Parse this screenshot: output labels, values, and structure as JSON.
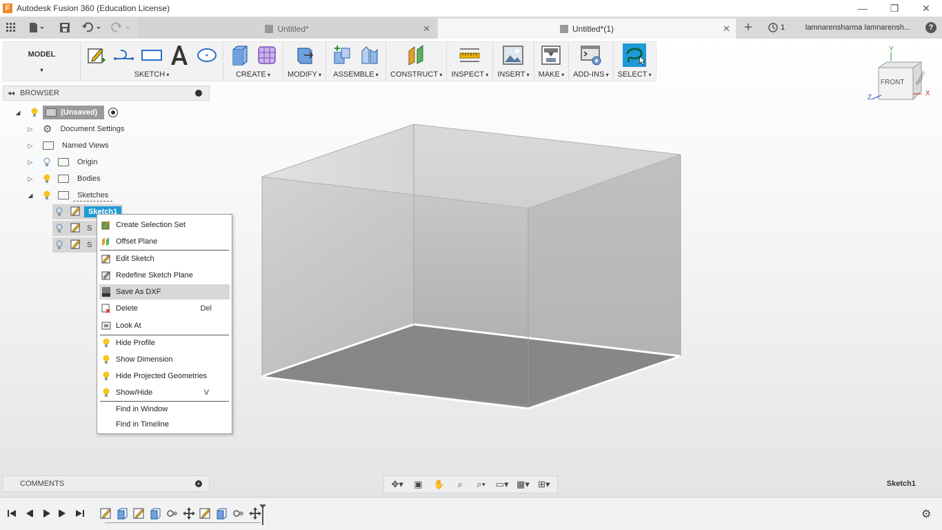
{
  "window": {
    "title": "Autodesk Fusion 360 (Education License)",
    "logo_letter": "F"
  },
  "tabs": [
    {
      "label": "Untitled*",
      "active": false
    },
    {
      "label": "Untitled*(1)",
      "active": true
    }
  ],
  "header": {
    "job_count": "1",
    "user": "lamnarensharma lamnarensh...",
    "help": "?"
  },
  "toolbar": {
    "workspace": "MODEL",
    "groups": [
      "SKETCH",
      "CREATE",
      "MODIFY",
      "ASSEMBLE",
      "CONSTRUCT",
      "INSPECT",
      "INSERT",
      "MAKE",
      "ADD-INS",
      "SELECT"
    ]
  },
  "viewcube": {
    "front": "FRONT",
    "right": "RIGHT",
    "axis_x": "X",
    "axis_y": "Y",
    "axis_z": "Z"
  },
  "browser": {
    "title": "BROWSER",
    "root": "(Unsaved)",
    "items": [
      "Document Settings",
      "Named Views",
      "Origin",
      "Bodies",
      "Sketches"
    ],
    "sketches": [
      "Sketch1",
      "S",
      "S"
    ]
  },
  "context_menu": {
    "items": [
      {
        "label": "Create Selection Set",
        "shortcut": "",
        "icon": "selection-set-icon"
      },
      {
        "label": "Offset Plane",
        "shortcut": "",
        "icon": "offset-plane-icon"
      },
      {
        "label": "Edit Sketch",
        "shortcut": "",
        "icon": "edit-sketch-icon"
      },
      {
        "label": "Redefine Sketch Plane",
        "shortcut": "",
        "icon": "redefine-plane-icon"
      },
      {
        "label": "Save As DXF",
        "shortcut": "",
        "icon": "dxf-icon",
        "highlighted": true
      },
      {
        "label": "Delete",
        "shortcut": "Del",
        "icon": "delete-icon"
      },
      {
        "label": "Look At",
        "shortcut": "",
        "icon": "look-at-icon"
      },
      {
        "label": "Hide Profile",
        "shortcut": "",
        "icon": "bulb-icon"
      },
      {
        "label": "Show Dimension",
        "shortcut": "",
        "icon": "bulb-icon"
      },
      {
        "label": "Hide Projected Geometries",
        "shortcut": "",
        "icon": "bulb-icon"
      },
      {
        "label": "Show/Hide",
        "shortcut": "V",
        "icon": "bulb-icon"
      },
      {
        "label": "Find in Window",
        "shortcut": "",
        "icon": ""
      },
      {
        "label": "Find in Timeline",
        "shortcut": "",
        "icon": ""
      }
    ]
  },
  "comments": {
    "title": "COMMENTS"
  },
  "status": {
    "selection": "Sketch1"
  },
  "colors": {
    "accent": "#1e9ad6",
    "bulb": "#f5c518",
    "logo": "#f08a24"
  }
}
